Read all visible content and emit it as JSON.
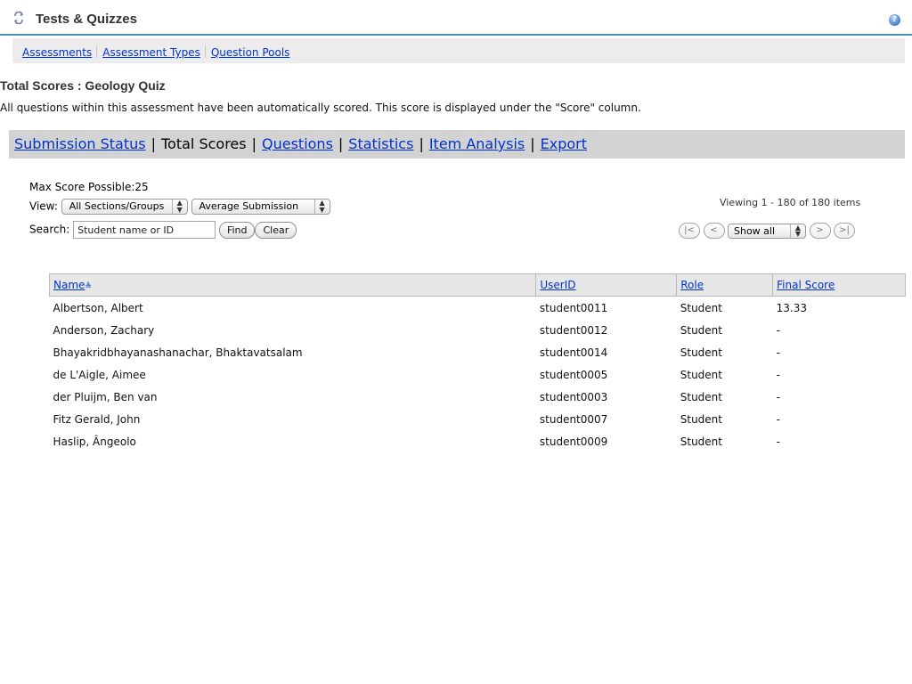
{
  "tool_title": "Tests & Quizzes",
  "help_icon": "?",
  "top_nav": [
    "Assessments",
    "Assessment Types",
    "Question Pools"
  ],
  "page": {
    "title": "Total Scores : Geology Quiz",
    "instructions": "All questions within this assessment have been automatically scored. This score is displayed under the \"Score\" column."
  },
  "sub_nav": {
    "submission_status": "Submission Status",
    "total_scores": "Total Scores",
    "questions": "Questions",
    "statistics": "Statistics",
    "item_analysis": "Item Analysis",
    "export": "Export",
    "separator": "|"
  },
  "controls": {
    "max_score": "Max Score Possible:25",
    "view_label": "View:",
    "sections_select": "All Sections/Groups",
    "submission_select": "Average Submission",
    "search_label": "Search:",
    "search_value": "Student name or ID",
    "find_button": "Find",
    "clear_button": "Clear"
  },
  "pager": {
    "viewing": "Viewing 1 - 180 of 180 items",
    "first": "|<",
    "prev": "<",
    "show": "Show all",
    "next": ">",
    "last": ">|"
  },
  "table": {
    "headers": {
      "name": "Name",
      "userid": "UserID",
      "role": "Role",
      "final_score": "Final Score"
    },
    "rows": [
      {
        "name": "Albertson, Albert",
        "userid": "student0011",
        "role": "Student",
        "score": "13.33"
      },
      {
        "name": "Anderson, Zachary",
        "userid": "student0012",
        "role": "Student",
        "score": "-"
      },
      {
        "name": "Bhayakridbhayanashanachar, Bhaktavatsalam",
        "userid": "student0014",
        "role": "Student",
        "score": "-"
      },
      {
        "name": "de L'Aigle, Aimee",
        "userid": "student0005",
        "role": "Student",
        "score": "-"
      },
      {
        "name": "der Pluijm, Ben van",
        "userid": "student0003",
        "role": "Student",
        "score": "-"
      },
      {
        "name": "Fitz Gerald, John",
        "userid": "student0007",
        "role": "Student",
        "score": "-"
      },
      {
        "name": "Haslip, Ângeolo",
        "userid": "student0009",
        "role": "Student",
        "score": "-"
      }
    ]
  }
}
